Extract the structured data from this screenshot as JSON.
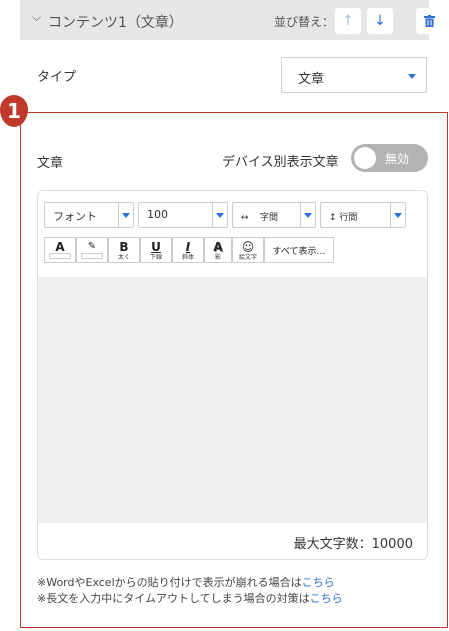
{
  "header": {
    "title": "コンテンツ1（文章）",
    "sort_label": "並び替え：",
    "icons": [
      "chevron-down-icon",
      "arrow-up-icon",
      "arrow-down-icon",
      "trash-icon"
    ]
  },
  "type_row": {
    "label": "タイプ",
    "selected": "文章"
  },
  "callout_number": "1",
  "section": {
    "label": "文章",
    "device_label": "デバイス別表示文章",
    "toggle_text": "無効"
  },
  "toolbar": {
    "font": "フォント",
    "size": "100",
    "letter_spacing": "字間",
    "line_spacing": "行間",
    "buttons": {
      "bold": "B",
      "bold_sub": "太く",
      "underline": "U",
      "underline_sub": "下線",
      "italic": "I",
      "italic_sub": "斜体",
      "shadow": "A",
      "shadow_sub": "影",
      "emoji_sub": "絵文字",
      "show_all": "すべて表示…"
    },
    "font_color_glyph": "A"
  },
  "editor": {
    "max_chars": "最大文字数：10000"
  },
  "notes": [
    {
      "text": "※WordやExcelからの貼り付けで表示が崩れる場合は",
      "link": "こちら"
    },
    {
      "text": "※長文を入力中にタイムアウトしてしまう場合の対策は",
      "link": "こちら"
    }
  ]
}
